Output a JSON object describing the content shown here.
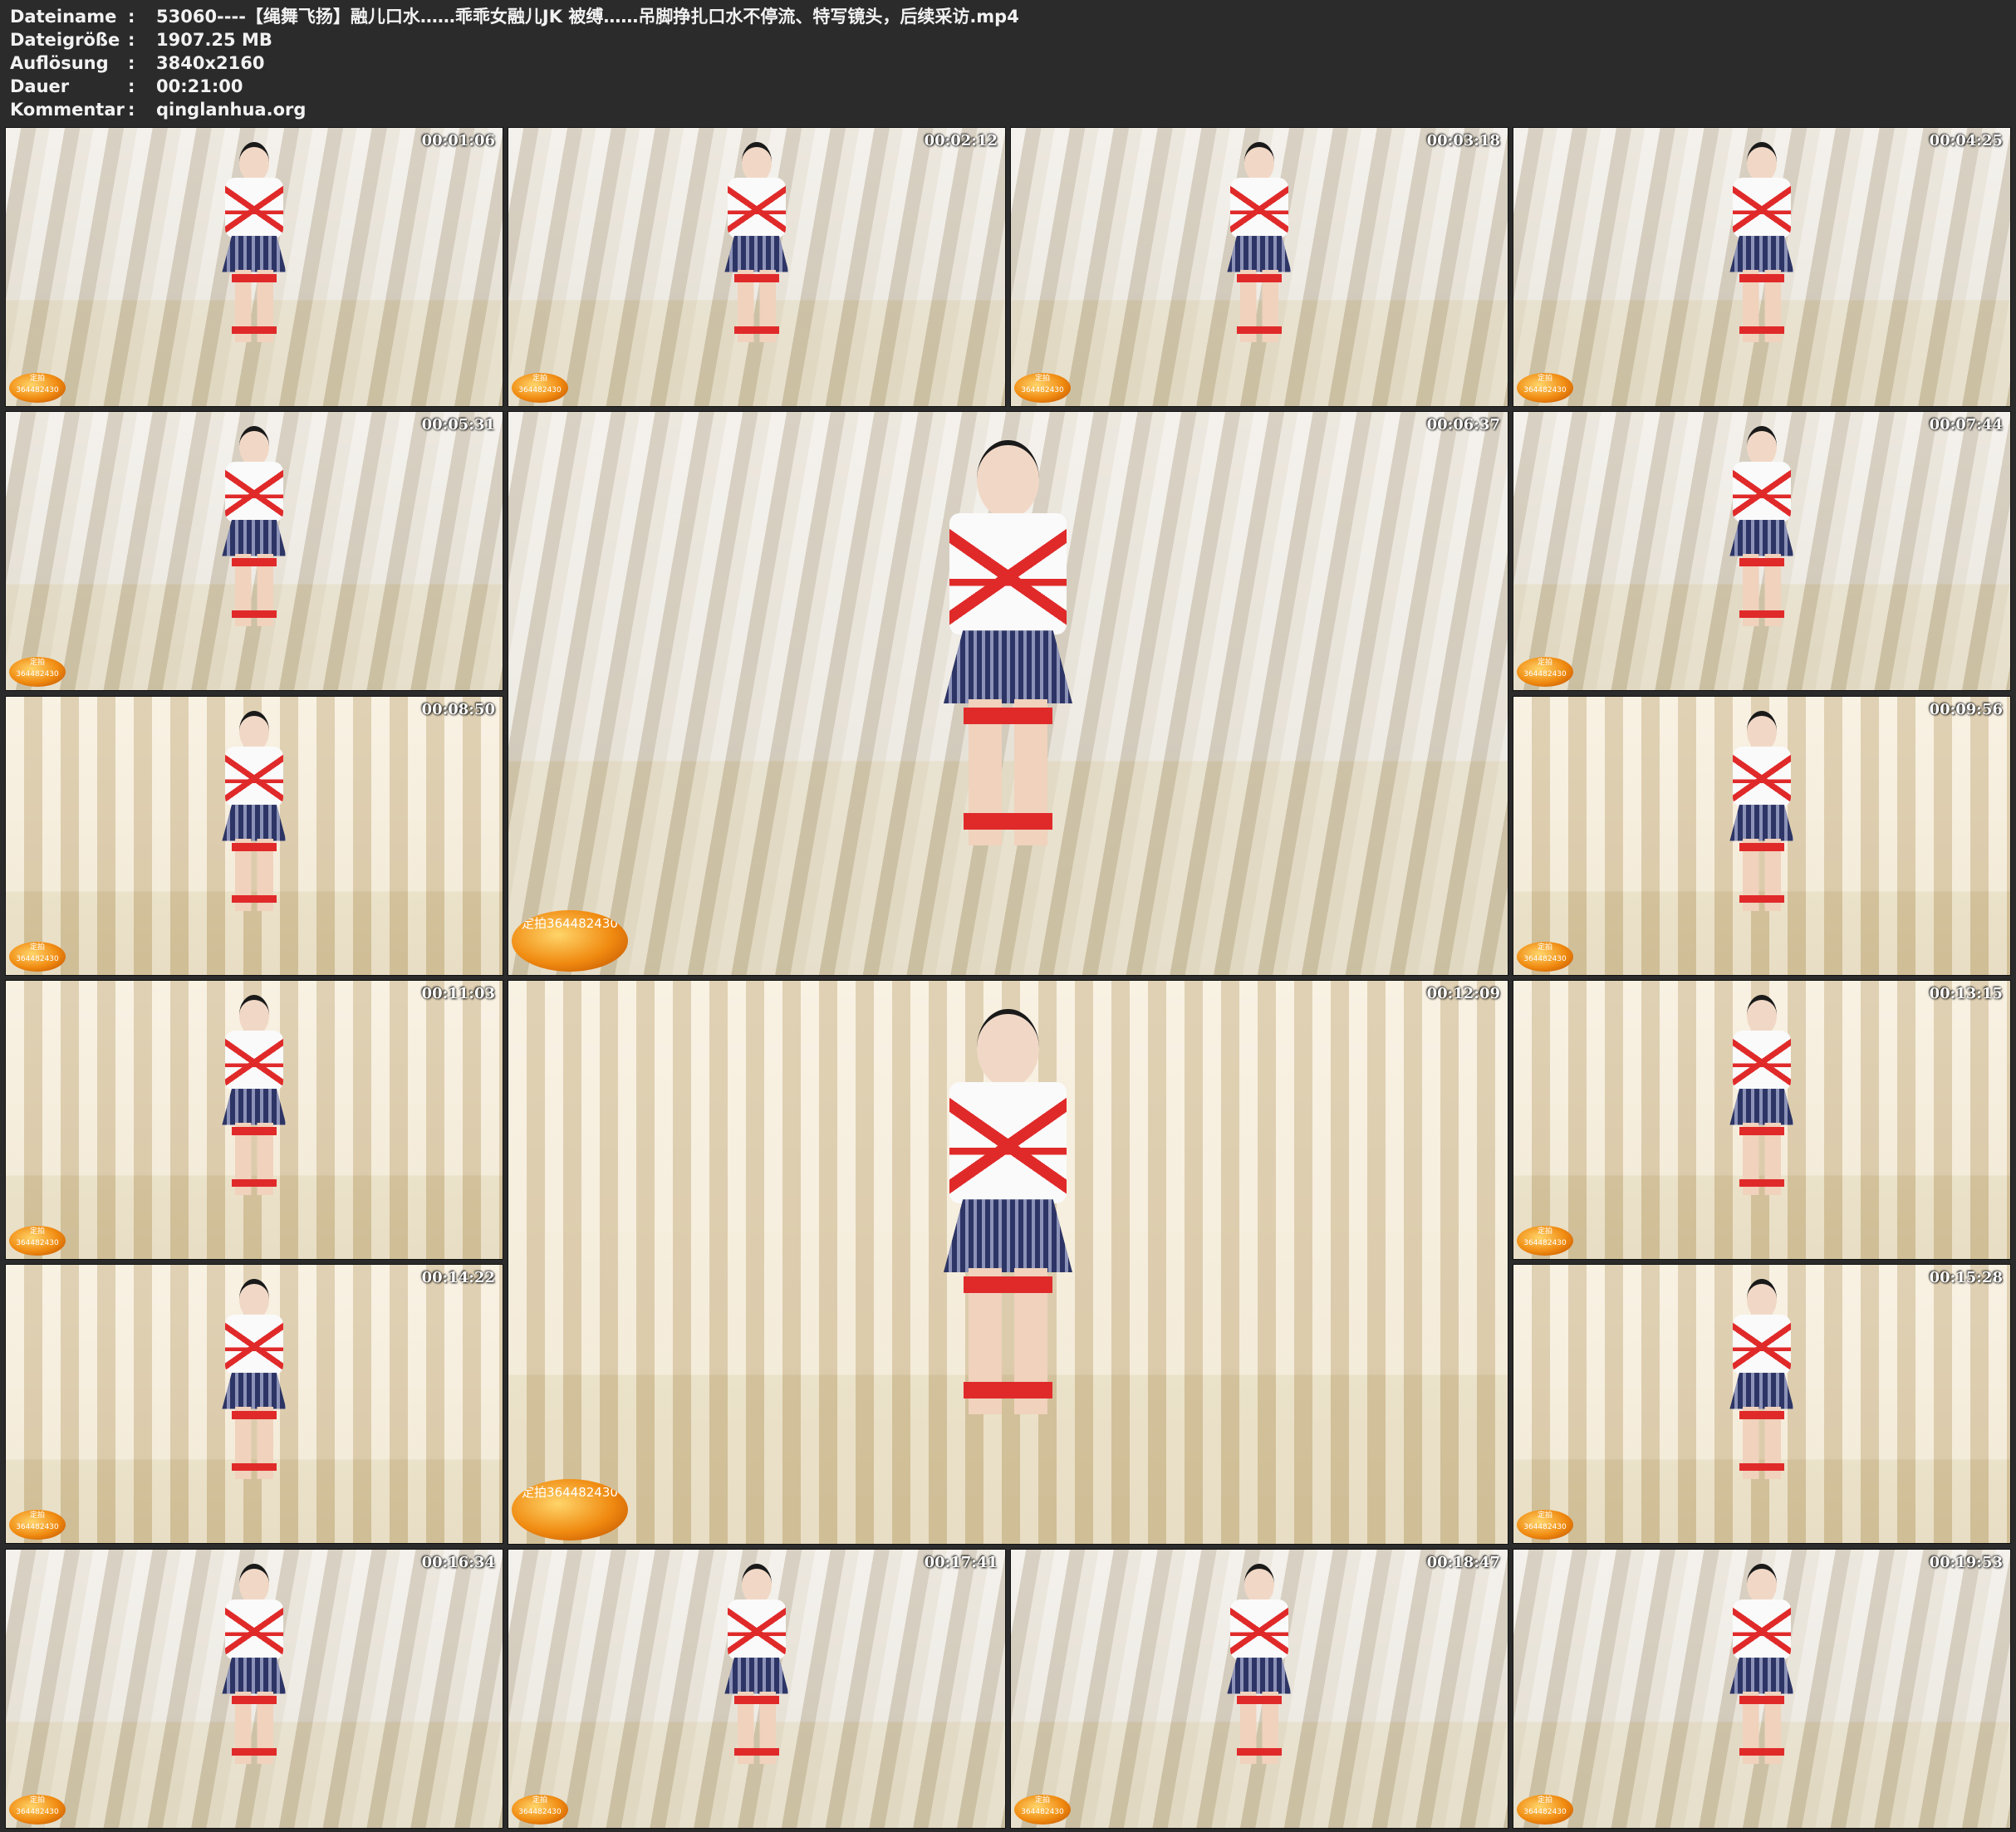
{
  "file_info": [
    {
      "key": "Dateiname",
      "value": "53060----【绳舞飞扬】融儿口水……乖乖女融儿JK 被缚……吊脚挣扎口水不停流、特写镜头，后续采访.mp4"
    },
    {
      "key": "Dateigröße",
      "value": "1907.25 MB"
    },
    {
      "key": "Auflösung",
      "value": "3840x2160"
    },
    {
      "key": "Dauer",
      "value": "00:21:00"
    },
    {
      "key": "Kommentar",
      "value": "qinglanhua.org"
    }
  ],
  "separator": ":",
  "logo_text": "定拍364482430",
  "thumbnails": [
    {
      "timestamp": "00:01:06"
    },
    {
      "timestamp": "00:02:12"
    },
    {
      "timestamp": "00:03:18"
    },
    {
      "timestamp": "00:04:25"
    },
    {
      "timestamp": "00:05:31"
    },
    {
      "timestamp": "00:06:37"
    },
    {
      "timestamp": "00:07:44"
    },
    {
      "timestamp": "00:08:50"
    },
    {
      "timestamp": "00:09:56"
    },
    {
      "timestamp": "00:11:03"
    },
    {
      "timestamp": "00:12:09"
    },
    {
      "timestamp": "00:13:15"
    },
    {
      "timestamp": "00:14:22"
    },
    {
      "timestamp": "00:15:28"
    },
    {
      "timestamp": "00:16:34"
    },
    {
      "timestamp": "00:17:41"
    },
    {
      "timestamp": "00:18:47"
    },
    {
      "timestamp": "00:19:53"
    }
  ]
}
